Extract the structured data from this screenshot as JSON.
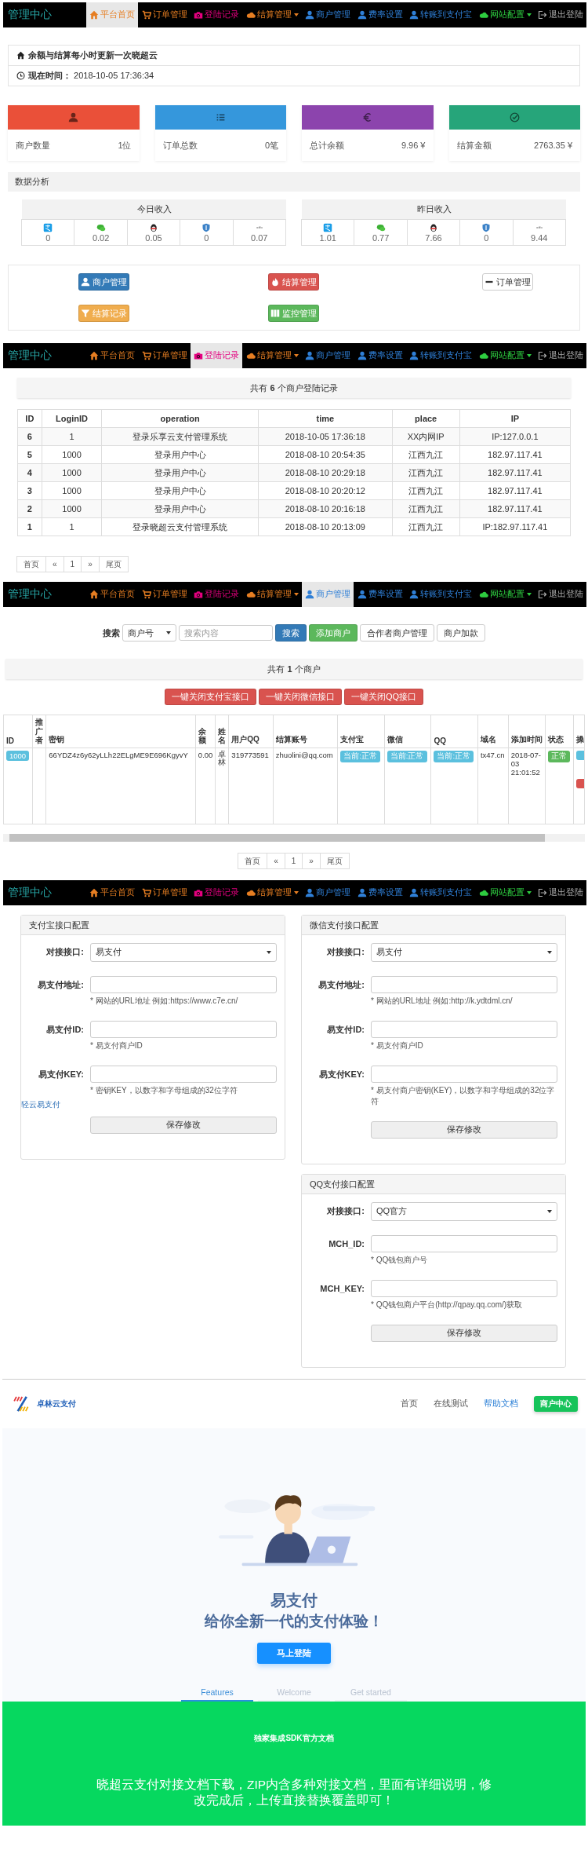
{
  "dashboard": {
    "navbar": {
      "brand": "管理中心",
      "items": [
        {
          "label": "平台首页",
          "color": "#e67e22",
          "dropdown": false,
          "selected": true
        },
        {
          "label": "订单管理",
          "color": "#e67e22",
          "dropdown": false,
          "selected": false
        },
        {
          "label": "登陆记录",
          "color": "#e4007f",
          "dropdown": false,
          "selected": false
        },
        {
          "label": "结算管理",
          "color": "#e67e22",
          "dropdown": true,
          "selected": false
        },
        {
          "label": "商户管理",
          "color": "#2f7fd6",
          "dropdown": false,
          "selected": false
        },
        {
          "label": "费率设置",
          "color": "#2f7fd6",
          "dropdown": false,
          "selected": false
        },
        {
          "label": "转账到支付宝",
          "color": "#2f7fd6",
          "dropdown": false,
          "selected": false
        },
        {
          "label": "网站配置",
          "color": "#2ecc40",
          "dropdown": true,
          "selected": false
        },
        {
          "label": "退出登陆",
          "color": "#aaaaaa",
          "dropdown": false,
          "selected": false
        }
      ]
    },
    "notice": "余额与结算每小时更新一次晓超云",
    "current_time": "**现在时间：** 2018-10-05 17:36:34",
    "stats": [
      {
        "label": "商户数量",
        "value": "1位",
        "color": "#ea5039"
      },
      {
        "label": "订单总数",
        "value": "0笔",
        "color": "#3597dc"
      },
      {
        "label": "总计余额",
        "value": "9.96 ¥",
        "color": "#8c44ad"
      },
      {
        "label": "结算金额",
        "value": "2763.35 ¥",
        "color": "#26a57a"
      }
    ],
    "analysis_title": "数据分析",
    "income": [
      {
        "title": "今日收入",
        "values": [
          "0",
          "0.02",
          "0.05",
          "0",
          "0.07"
        ]
      },
      {
        "title": "昨日收入",
        "values": [
          "1.01",
          "0.77",
          "7.66",
          "0",
          "9.44"
        ]
      }
    ],
    "shortcuts": [
      {
        "label": "商户管理",
        "color": "#337ab7"
      },
      {
        "label": "结算管理",
        "color": "#d9534f"
      },
      {
        "label": "订单管理",
        "color": "#ffffff"
      },
      {
        "label": "结算记录",
        "color": "#f0ad4e"
      },
      {
        "label": "监控管理",
        "color": "#5cb85c"
      }
    ]
  },
  "login_records": {
    "navbar": {
      "brand": "管理中心",
      "items": [
        {
          "label": "平台首页",
          "color": "#e67e22",
          "dropdown": false,
          "selected": false
        },
        {
          "label": "订单管理",
          "color": "#e67e22",
          "dropdown": false,
          "selected": false
        },
        {
          "label": "登陆记录",
          "color": "#e4007f",
          "dropdown": false,
          "selected": true
        },
        {
          "label": "结算管理",
          "color": "#e67e22",
          "dropdown": true,
          "selected": false
        },
        {
          "label": "商户管理",
          "color": "#2f7fd6",
          "dropdown": false,
          "selected": false
        },
        {
          "label": "费率设置",
          "color": "#2f7fd6",
          "dropdown": false,
          "selected": false
        },
        {
          "label": "转账到支付宝",
          "color": "#2f7fd6",
          "dropdown": false,
          "selected": false
        },
        {
          "label": "网站配置",
          "color": "#2ecc40",
          "dropdown": true,
          "selected": false
        },
        {
          "label": "退出登陆",
          "color": "#aaaaaa",
          "dropdown": false,
          "selected": false
        }
      ]
    },
    "summary": "共有 **6** 个商户登陆记录",
    "columns": [
      "ID",
      "LoginID",
      "operation",
      "time",
      "place",
      "IP"
    ],
    "rows": [
      {
        "id": "6",
        "login_id": "1",
        "operation": "登录乐享云支付管理系统",
        "time": "2018-10-05 17:36:18",
        "place": "XX内网IP",
        "ip": "IP:127.0.0.1"
      },
      {
        "id": "5",
        "login_id": "1000",
        "operation": "登录用户中心",
        "time": "2018-08-10 20:54:35",
        "place": "江西九江",
        "ip": "182.97.117.41"
      },
      {
        "id": "4",
        "login_id": "1000",
        "operation": "登录用户中心",
        "time": "2018-08-10 20:29:18",
        "place": "江西九江",
        "ip": "182.97.117.41"
      },
      {
        "id": "3",
        "login_id": "1000",
        "operation": "登录用户中心",
        "time": "2018-08-10 20:20:12",
        "place": "江西九江",
        "ip": "182.97.117.41"
      },
      {
        "id": "2",
        "login_id": "1000",
        "operation": "登录用户中心",
        "time": "2018-08-10 20:16:18",
        "place": "江西九江",
        "ip": "182.97.117.41"
      },
      {
        "id": "1",
        "login_id": "1",
        "operation": "登录晓超云支付管理系统",
        "time": "2018-08-10 20:13:09",
        "place": "江西九江",
        "ip": "IP:182.97.117.41"
      }
    ],
    "pagination": [
      "首页",
      "«",
      "1",
      "»",
      "尾页"
    ]
  },
  "merchants": {
    "navbar": {
      "brand": "管理中心",
      "items": [
        {
          "label": "平台首页",
          "color": "#e67e22",
          "dropdown": false,
          "selected": false
        },
        {
          "label": "订单管理",
          "color": "#e67e22",
          "dropdown": false,
          "selected": false
        },
        {
          "label": "登陆记录",
          "color": "#e4007f",
          "dropdown": false,
          "selected": false
        },
        {
          "label": "结算管理",
          "color": "#e67e22",
          "dropdown": true,
          "selected": false
        },
        {
          "label": "商户管理",
          "color": "#2f7fd6",
          "dropdown": false,
          "selected": true
        },
        {
          "label": "费率设置",
          "color": "#2f7fd6",
          "dropdown": false,
          "selected": false
        },
        {
          "label": "转账到支付宝",
          "color": "#2f7fd6",
          "dropdown": false,
          "selected": false
        },
        {
          "label": "网站配置",
          "color": "#2ecc40",
          "dropdown": true,
          "selected": false
        },
        {
          "label": "退出登陆",
          "color": "#aaaaaa",
          "dropdown": false,
          "selected": false
        }
      ]
    },
    "search": {
      "label": "搜索",
      "select": "商户号",
      "placeholder": "搜索内容",
      "buttons": [
        {
          "label": "搜索",
          "color": "#337ab7"
        },
        {
          "label": "添加商户",
          "color": "#5cb85c"
        },
        {
          "label": "合作者商户管理",
          "color": "#ffffff"
        },
        {
          "label": "商户加款",
          "color": "#ffffff"
        }
      ]
    },
    "summary": "共有 **1** 个商户",
    "bulk_buttons": [
      "一键关闭支付宝接口",
      "一键关闭微信接口",
      "一键关闭QQ接口"
    ],
    "columns": [
      "ID",
      "推广者",
      "密钥",
      "余额",
      "姓名",
      "用户QQ",
      "结算账号",
      "支付宝",
      "微信",
      "QQ",
      "域名",
      "添加时间",
      "状态",
      "操"
    ],
    "rows": [
      {
        "id": "1000",
        "key": "66YDZ4z6y62yLLh22ELgME9E696KgyvY",
        "balance": "0.00",
        "name": "卓林",
        "qq": "319773591",
        "account": "zhuolini@qq.com",
        "alipay": "当前:正常",
        "wechat": "当前:正常",
        "qq_pay": "当前:正常",
        "domain": "tx47.cn",
        "added": "2018-07-03 21:01:52",
        "status": "正常"
      }
    ],
    "pagination": [
      "首页",
      "«",
      "1",
      "»",
      "尾页"
    ]
  },
  "payment_config": {
    "navbar": {
      "brand": "管理中心",
      "items": [
        {
          "label": "平台首页",
          "color": "#e67e22",
          "dropdown": false,
          "selected": false
        },
        {
          "label": "订单管理",
          "color": "#e67e22",
          "dropdown": false,
          "selected": false
        },
        {
          "label": "登陆记录",
          "color": "#e4007f",
          "dropdown": false,
          "selected": false
        },
        {
          "label": "结算管理",
          "color": "#e67e22",
          "dropdown": true,
          "selected": false
        },
        {
          "label": "商户管理",
          "color": "#2f7fd6",
          "dropdown": false,
          "selected": false
        },
        {
          "label": "费率设置",
          "color": "#2f7fd6",
          "dropdown": false,
          "selected": false
        },
        {
          "label": "转账到支付宝",
          "color": "#2f7fd6",
          "dropdown": false,
          "selected": false
        },
        {
          "label": "网站配置",
          "color": "#2ecc40",
          "dropdown": true,
          "selected": false
        },
        {
          "label": "退出登陆",
          "color": "#aaaaaa",
          "dropdown": false,
          "selected": false
        }
      ]
    },
    "panels": [
      {
        "title": "支付宝接口配置",
        "fields": [
          {
            "kind": "select",
            "label": "对接接口:",
            "value": "易支付"
          },
          {
            "kind": "input",
            "label": "易支付地址:",
            "help": "* 网站的URL地址 例如:https://www.c7e.cn/"
          },
          {
            "kind": "input",
            "label": "易支付ID:",
            "help": "* 易支付商户ID"
          },
          {
            "kind": "input",
            "label": "易支付KEY:",
            "help": "* 密钥KEY，以数字和字母组成的32位字符"
          }
        ],
        "link": "轻云易支付",
        "button": "保存修改"
      },
      {
        "title": "微信支付接口配置",
        "fields": [
          {
            "kind": "select",
            "label": "对接接口:",
            "value": "易支付"
          },
          {
            "kind": "input",
            "label": "易支付地址:",
            "help": "* 网站的URL地址 例如:http://k.ydtdml.cn/"
          },
          {
            "kind": "input",
            "label": "易支付ID:",
            "help": "* 易支付商户ID"
          },
          {
            "kind": "input",
            "label": "易支付KEY:",
            "help": "* 易支付商户密钥(KEY)，以数字和字母组成的32位字符"
          }
        ],
        "button": "保存修改"
      },
      {
        "title": "QQ支付接口配置",
        "fields": [
          {
            "kind": "select",
            "label": "对接接口:",
            "value": "QQ官方"
          },
          {
            "kind": "input",
            "label": "MCH_ID:",
            "help": "* QQ钱包商户号"
          },
          {
            "kind": "input",
            "label": "MCH_KEY:",
            "help": "* QQ钱包商户平台(http://qpay.qq.com/)获取"
          }
        ],
        "button": "保存修改"
      }
    ]
  },
  "landing": {
    "logo": "卓林云支付",
    "nav": [
      {
        "label": "首页",
        "selected": false
      },
      {
        "label": "在线测试",
        "selected": false
      },
      {
        "label": "帮助文档",
        "selected": true
      }
    ],
    "cta_button": "商户中心",
    "title": "易支付",
    "subtitle": "给你全新一代的支付体验！",
    "login_button": "马上登陆",
    "tabs": [
      {
        "label": "Features",
        "selected": true
      },
      {
        "label": "Welcome",
        "selected": false
      },
      {
        "label": "Get started",
        "selected": false
      }
    ],
    "docs": {
      "kicker": "独家集成SDK官方文档",
      "text": "晓超云支付对接文档下载，ZIP内含多种对接文档，里面有详细说明，修改完成后，上传直接替换覆盖即可！"
    }
  }
}
